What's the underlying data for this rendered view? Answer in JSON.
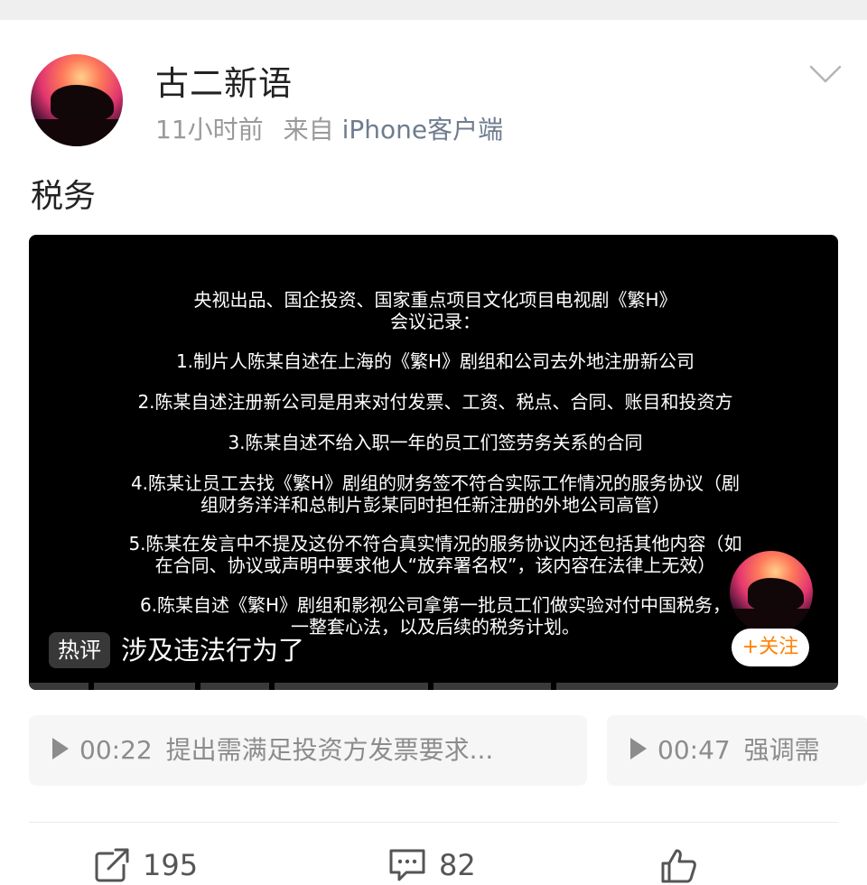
{
  "post": {
    "username": "古二新语",
    "time": "11小时前",
    "source_prefix": "来自",
    "source_client": "iPhone客户端",
    "text": "税务"
  },
  "video": {
    "document_lines": [
      "央视出品、国企投资、国家重点项目文化项目电视剧《繁H》",
      "会议记录：",
      "1.制片人陈某自述在上海的《繁H》剧组和公司去外地注册新公司",
      "2.陈某自述注册新公司是用来对付发票、工资、税点、合同、账目和投资方",
      "3.陈某自述不给入职一年的员工们签劳务关系的合同",
      "4.陈某让员工去找《繁H》剧组的财务签不符合实际工作情况的服务协议（剧",
      "组财务洋洋和总制片彭某同时担任新注册的外地公司高管）",
      "5.陈某在发言中不提及这份不符合真实情况的服务协议内还包括其他内容（如",
      "在合同、协议或声明中要求他人“放弃署名权”，该内容在法律上无效）",
      "6.陈某自述《繁H》剧组和影视公司拿第一批员工们做实验对付中国税务，",
      "一整套心法，以及后续的税务计划。"
    ],
    "hot_badge": "热评",
    "hot_comment": "涉及违法行为了",
    "follow_label": "+关注"
  },
  "chapters": [
    {
      "time": "00:22",
      "title": "提出需满足投资方发票要求..."
    },
    {
      "time": "00:47",
      "title": "强调需"
    }
  ],
  "actions": {
    "share_count": "195",
    "comment_count": "82"
  },
  "colors": {
    "follow_accent": "#ff8200",
    "client_link": "#6f7c8f",
    "muted": "#9a9a9a"
  }
}
